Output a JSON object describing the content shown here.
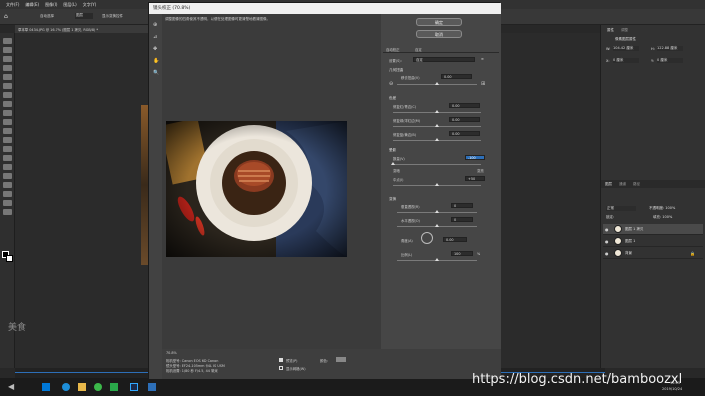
{
  "menubar": {
    "items": [
      "文件(F)",
      "编辑(E)",
      "图像(I)",
      "图层(L)",
      "文字(Y)",
      "选择(S)",
      "滤镜(T)",
      "3D(D)",
      "视图(V)",
      "窗口(W)",
      "帮助(H)"
    ]
  },
  "options": {
    "auto_select": "自动选择",
    "group": "图层",
    "show_transform": "显示变换控件"
  },
  "doc_tab": "草本草 0434.JPG @ 16.7% (图层 1 拷贝, RGB/8) *",
  "dialog": {
    "title": "镜头校正 (70.8%)",
    "preview_hint": "调整图像的四角使其不透明，以便在处理图像时更清楚地看清图像。",
    "ok": "确定",
    "cancel": "取消",
    "tab_auto": "自动校正",
    "tab_custom": "自定",
    "settings_label": "设置(S):",
    "settings_value": "自定",
    "geo_section": "几何扭曲",
    "geo_label": "移去扭曲(V)",
    "geo_value": "0.00",
    "chroma_section": "色差",
    "chroma1": "修复红/青边(C)",
    "chroma1_val": "0.00",
    "chroma2": "修复绿/洋红边(M)",
    "chroma2_val": "0.00",
    "chroma3": "修复蓝/黄边(B)",
    "chroma3_val": "0.00",
    "vig_section": "晕影",
    "vig_amount": "数量(V)",
    "vig_amount_val": "-100",
    "vig_dark": "变暗",
    "vig_light": "变亮",
    "vig_mid": "中点(I)",
    "vig_mid_val": "+50",
    "trans_section": "变换",
    "vert": "垂直透视(R)",
    "vert_val": "0",
    "horiz": "水平透视(O)",
    "horiz_val": "0",
    "angle": "角度(A)",
    "angle_val": "0.00",
    "scale": "比例(L)",
    "scale_val": "100",
    "scale_unit": "%",
    "zoom": "70.8%",
    "camera_lines": [
      "相机型号: Canon EOS 6D Canon",
      "镜头型号: EF24-105mm f/4L IS USM",
      "相机设置: 1/80 秒 F/4.5, 44 毫米"
    ],
    "preview_chk": "预览(P)",
    "grid_chk": "显示网格(W)",
    "color_label": "颜色:"
  },
  "panels": {
    "properties_tab": "属性",
    "adjust_tab": "调整",
    "pixel_layer": "像素图层属性",
    "w_label": "W:",
    "w_val": "104.42 厘米",
    "h_label": "H:",
    "h_val": "122.88 厘米",
    "x_label": "X:",
    "x_val": "0 厘米",
    "y_label": "Y:",
    "y_val": "0 厘米",
    "layers_tab": "图层",
    "channels_tab": "通道",
    "paths_tab": "路径",
    "blend": "正常",
    "opacity": "不透明度: 100%",
    "lock": "锁定:",
    "fill": "填充: 100%",
    "layers": [
      {
        "name": "图层 1 拷贝"
      },
      {
        "name": "图层 1"
      },
      {
        "name": "背景"
      }
    ]
  },
  "watermark": "美食",
  "url_watermark": "https://blog.csdn.net/bamboozxl",
  "taskbar": {
    "time": "16:05",
    "date": "2019/10/24"
  },
  "colors": {
    "accent": "#2d6fb8",
    "dialog_bg": "#535353"
  }
}
